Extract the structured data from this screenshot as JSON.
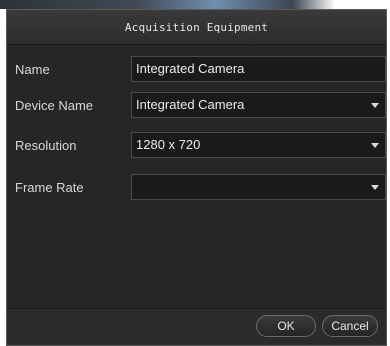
{
  "dialog": {
    "title": "Acquisition Equipment"
  },
  "form": {
    "name": {
      "label": "Name",
      "value": "Integrated Camera"
    },
    "device_name": {
      "label": "Device Name",
      "value": "Integrated Camera"
    },
    "resolution": {
      "label": "Resolution",
      "value": "1280 x 720"
    },
    "frame_rate": {
      "label": "Frame Rate",
      "value": ""
    }
  },
  "buttons": {
    "ok": "OK",
    "cancel": "Cancel"
  },
  "icons": {
    "dropdown": "chevron-down-icon"
  },
  "colors": {
    "dialog_bg": "#262626",
    "field_bg": "#1a1a1a",
    "text": "#ececec"
  }
}
